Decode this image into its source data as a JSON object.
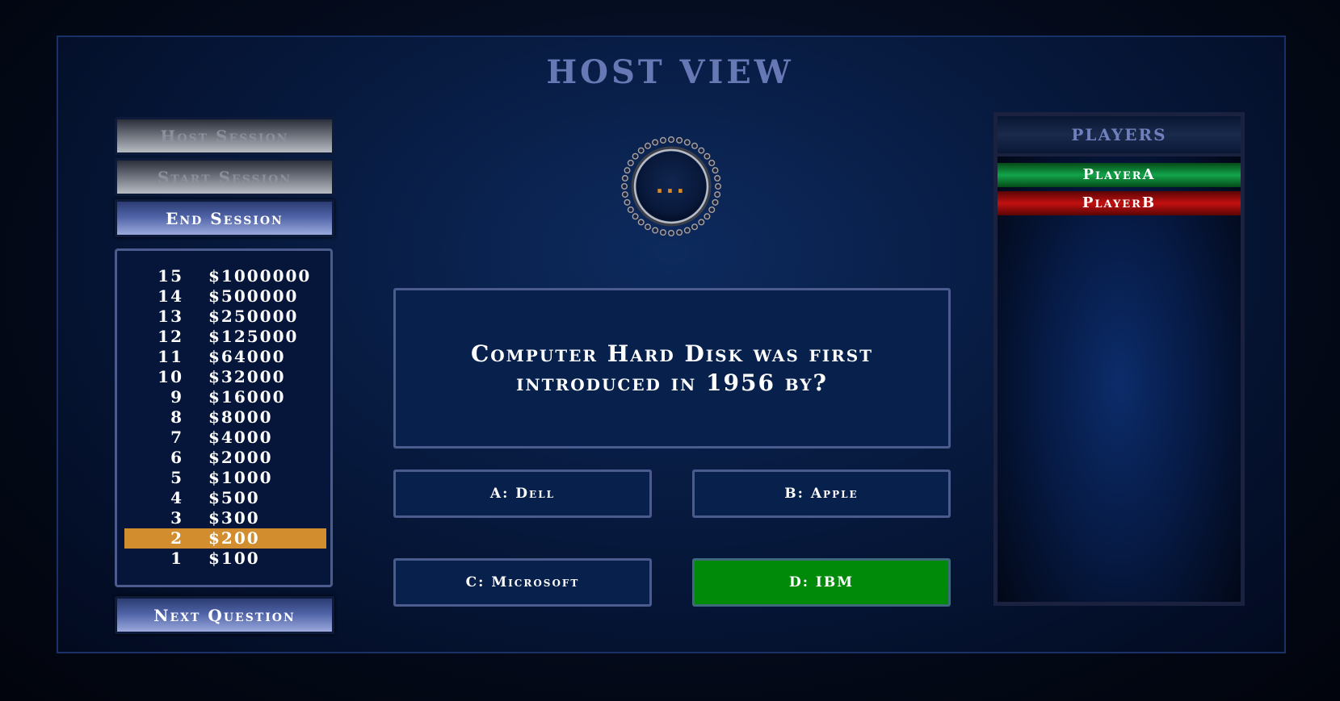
{
  "title": "HOST VIEW",
  "controls": {
    "host_session": "Host Session",
    "start_session": "Start Session",
    "end_session": "End Session",
    "next_question": "Next Question"
  },
  "ladder": [
    {
      "level": "15",
      "amount": "$1000000"
    },
    {
      "level": "14",
      "amount": "$500000"
    },
    {
      "level": "13",
      "amount": "$250000"
    },
    {
      "level": "12",
      "amount": "$125000"
    },
    {
      "level": "11",
      "amount": "$64000"
    },
    {
      "level": "10",
      "amount": "$32000"
    },
    {
      "level": "9",
      "amount": "$16000"
    },
    {
      "level": "8",
      "amount": "$8000"
    },
    {
      "level": "7",
      "amount": "$4000"
    },
    {
      "level": "6",
      "amount": "$2000"
    },
    {
      "level": "5",
      "amount": "$1000"
    },
    {
      "level": "4",
      "amount": "$500"
    },
    {
      "level": "3",
      "amount": "$300"
    },
    {
      "level": "2",
      "amount": "$200"
    },
    {
      "level": "1",
      "amount": "$100"
    }
  ],
  "current_level": "2",
  "timer": {
    "text": "..."
  },
  "question": {
    "text": "Computer Hard Disk was first introduced in 1956 by?"
  },
  "answers": {
    "a": "A: Dell",
    "b": "B: Apple",
    "c": "C: Microsoft",
    "d": "D: IBM"
  },
  "correct_answer": "d",
  "players": {
    "header": "PLAYERS",
    "list": [
      {
        "name": "PlayerA",
        "status": "green"
      },
      {
        "name": "PlayerB",
        "status": "red"
      }
    ]
  },
  "colors": {
    "accent": "#6878b4",
    "highlight": "#d18d2e",
    "correct": "#008a0a",
    "player_ok": "#12a44a",
    "player_out": "#c21010"
  }
}
